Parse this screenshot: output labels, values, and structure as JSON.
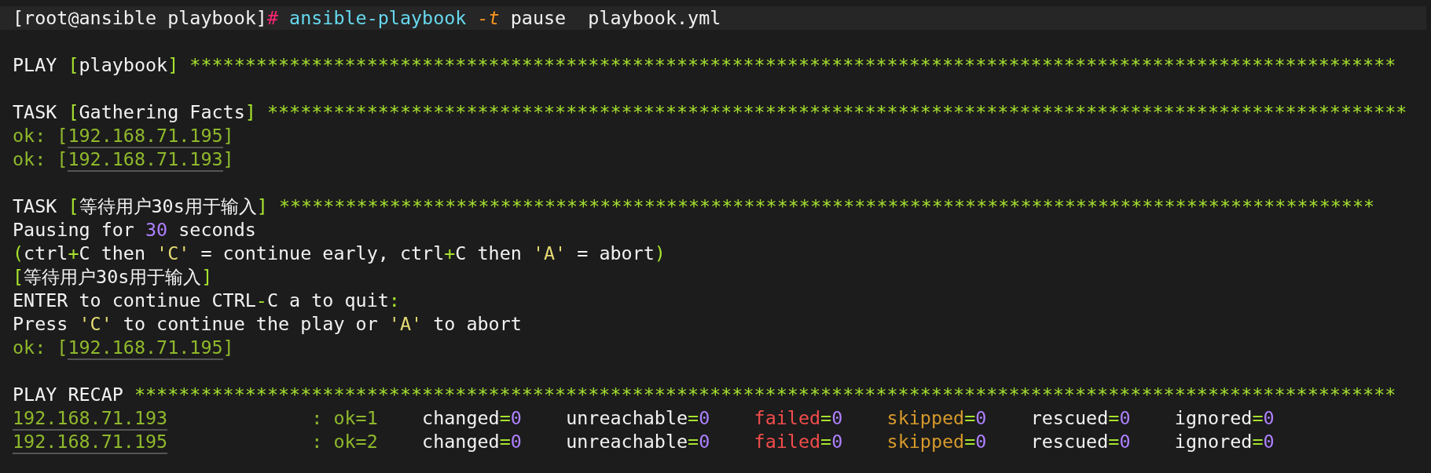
{
  "terminal": {
    "lines": [
      {
        "kind": "command",
        "segments": [
          {
            "kind": "text",
            "text": "[root@ansible playbook]"
          },
          {
            "kind": "prompt",
            "text": "# "
          },
          {
            "kind": "command",
            "text": "ansible-playbook "
          },
          {
            "kind": "flag",
            "text": "-t"
          },
          {
            "kind": "text",
            "text": " pause  playbook.yml"
          }
        ]
      },
      {
        "kind": "blank"
      },
      {
        "kind": "output",
        "segments": [
          {
            "kind": "text",
            "text": "PLAY "
          },
          {
            "kind": "punct",
            "text": "["
          },
          {
            "kind": "text",
            "text": "playbook"
          },
          {
            "kind": "punct",
            "text": "] "
          },
          {
            "kind": "stars",
            "text": "*************************************************************************************************************"
          }
        ]
      },
      {
        "kind": "blank"
      },
      {
        "kind": "output",
        "segments": [
          {
            "kind": "text",
            "text": "TASK "
          },
          {
            "kind": "punct",
            "text": "["
          },
          {
            "kind": "text",
            "text": "Gathering Facts"
          },
          {
            "kind": "punct",
            "text": "] "
          },
          {
            "kind": "stars",
            "text": "*******************************************************************************************************"
          }
        ]
      },
      {
        "kind": "output",
        "segments": [
          {
            "kind": "ok",
            "text": "ok: ["
          },
          {
            "kind": "host",
            "text": "192.168.71.195"
          },
          {
            "kind": "ok",
            "text": "]"
          }
        ]
      },
      {
        "kind": "output",
        "segments": [
          {
            "kind": "ok",
            "text": "ok: ["
          },
          {
            "kind": "host",
            "text": "192.168.71.193"
          },
          {
            "kind": "ok",
            "text": "]"
          }
        ]
      },
      {
        "kind": "blank"
      },
      {
        "kind": "output",
        "segments": [
          {
            "kind": "text",
            "text": "TASK "
          },
          {
            "kind": "punct",
            "text": "["
          },
          {
            "kind": "text",
            "text": "等待用户30s用于输入"
          },
          {
            "kind": "punct",
            "text": "] "
          },
          {
            "kind": "stars",
            "text": "***************************************************************************************************"
          }
        ]
      },
      {
        "kind": "output",
        "segments": [
          {
            "kind": "text",
            "text": "Pausing for "
          },
          {
            "kind": "number",
            "text": "30"
          },
          {
            "kind": "text",
            "text": " seconds"
          }
        ]
      },
      {
        "kind": "output",
        "segments": [
          {
            "kind": "punct",
            "text": "("
          },
          {
            "kind": "text",
            "text": "ctrl"
          },
          {
            "kind": "punct",
            "text": "+"
          },
          {
            "kind": "text",
            "text": "C then "
          },
          {
            "kind": "quote",
            "text": "'C'"
          },
          {
            "kind": "text",
            "text": " = continue early, ctrl"
          },
          {
            "kind": "punct",
            "text": "+"
          },
          {
            "kind": "text",
            "text": "C then "
          },
          {
            "kind": "quote",
            "text": "'A'"
          },
          {
            "kind": "text",
            "text": " = abort"
          },
          {
            "kind": "punct",
            "text": ")"
          }
        ]
      },
      {
        "kind": "output",
        "segments": [
          {
            "kind": "punct",
            "text": "["
          },
          {
            "kind": "text",
            "text": "等待用户30s用于输入"
          },
          {
            "kind": "punct",
            "text": "]"
          }
        ]
      },
      {
        "kind": "output",
        "segments": [
          {
            "kind": "text",
            "text": "ENTER to continue CTRL"
          },
          {
            "kind": "punct",
            "text": "-"
          },
          {
            "kind": "text",
            "text": "C a to quit"
          },
          {
            "kind": "punct",
            "text": ":"
          }
        ]
      },
      {
        "kind": "output",
        "segments": [
          {
            "kind": "text",
            "text": "Press "
          },
          {
            "kind": "quote",
            "text": "'C'"
          },
          {
            "kind": "text",
            "text": " to continue the play or "
          },
          {
            "kind": "quote",
            "text": "'A'"
          },
          {
            "kind": "text",
            "text": " to abort"
          }
        ]
      },
      {
        "kind": "output",
        "segments": [
          {
            "kind": "ok",
            "text": "ok: ["
          },
          {
            "kind": "host",
            "text": "192.168.71.195"
          },
          {
            "kind": "ok",
            "text": "]"
          }
        ]
      },
      {
        "kind": "blank"
      },
      {
        "kind": "output",
        "segments": [
          {
            "kind": "text",
            "text": "PLAY RECAP "
          },
          {
            "kind": "stars",
            "text": "******************************************************************************************************************"
          }
        ]
      },
      {
        "kind": "output",
        "segments": [
          {
            "kind": "host",
            "text": "192.168.71.193"
          },
          {
            "kind": "ok",
            "text": "             : ok=1"
          },
          {
            "kind": "text",
            "text": "    changed"
          },
          {
            "kind": "punct",
            "text": "="
          },
          {
            "kind": "number",
            "text": "0"
          },
          {
            "kind": "text",
            "text": "    unreachable"
          },
          {
            "kind": "punct",
            "text": "="
          },
          {
            "kind": "number",
            "text": "0"
          },
          {
            "kind": "failed",
            "text": "    failed"
          },
          {
            "kind": "punct",
            "text": "="
          },
          {
            "kind": "number",
            "text": "0"
          },
          {
            "kind": "skipped",
            "text": "    skipped"
          },
          {
            "kind": "punct",
            "text": "="
          },
          {
            "kind": "number",
            "text": "0"
          },
          {
            "kind": "text",
            "text": "    rescued"
          },
          {
            "kind": "punct",
            "text": "="
          },
          {
            "kind": "number",
            "text": "0"
          },
          {
            "kind": "text",
            "text": "    ignored"
          },
          {
            "kind": "punct",
            "text": "="
          },
          {
            "kind": "number",
            "text": "0"
          }
        ]
      },
      {
        "kind": "output",
        "segments": [
          {
            "kind": "host",
            "text": "192.168.71.195"
          },
          {
            "kind": "ok",
            "text": "             : ok=2"
          },
          {
            "kind": "text",
            "text": "    changed"
          },
          {
            "kind": "punct",
            "text": "="
          },
          {
            "kind": "number",
            "text": "0"
          },
          {
            "kind": "text",
            "text": "    unreachable"
          },
          {
            "kind": "punct",
            "text": "="
          },
          {
            "kind": "number",
            "text": "0"
          },
          {
            "kind": "failed",
            "text": "    failed"
          },
          {
            "kind": "punct",
            "text": "="
          },
          {
            "kind": "number",
            "text": "0"
          },
          {
            "kind": "skipped",
            "text": "    skipped"
          },
          {
            "kind": "punct",
            "text": "="
          },
          {
            "kind": "number",
            "text": "0"
          },
          {
            "kind": "text",
            "text": "    rescued"
          },
          {
            "kind": "punct",
            "text": "="
          },
          {
            "kind": "number",
            "text": "0"
          },
          {
            "kind": "text",
            "text": "    ignored"
          },
          {
            "kind": "punct",
            "text": "="
          },
          {
            "kind": "number",
            "text": "0"
          }
        ]
      }
    ]
  }
}
